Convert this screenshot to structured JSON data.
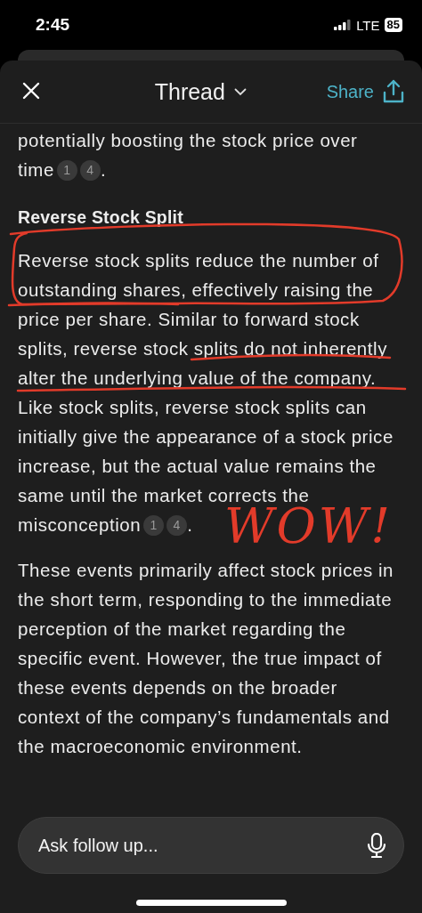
{
  "status_bar": {
    "time": "2:45",
    "network": "LTE",
    "battery": "85"
  },
  "header": {
    "title": "Thread",
    "share": "Share"
  },
  "content": [
    {
      "kind": "paragraph",
      "text": "potentially boosting the stock price over time",
      "citations": [
        "1",
        "4"
      ],
      "end": "."
    },
    {
      "kind": "heading",
      "text": "Reverse Stock Split"
    },
    {
      "kind": "paragraph",
      "text": "Reverse stock splits reduce the number of outstanding shares, effectively raising the price per share. Similar to forward stock splits, reverse stock splits do not inherently alter the underlying value of the company. Like stock splits, reverse stock splits can initially give the appearance of a stock price increase, but the actual value remains the same until the market corrects the misconception",
      "citations": [
        "1",
        "4"
      ],
      "end": "."
    },
    {
      "kind": "paragraph",
      "text": "These events primarily affect stock prices in the short term, responding to the immediate perception of the market regarding the specific event. However, the true impact of these events depends on the broader context of the company’s fundamentals and the macroeconomic environment."
    }
  ],
  "annotation": {
    "text": "WOW!"
  },
  "follow_up": {
    "placeholder": "Ask follow up..."
  }
}
